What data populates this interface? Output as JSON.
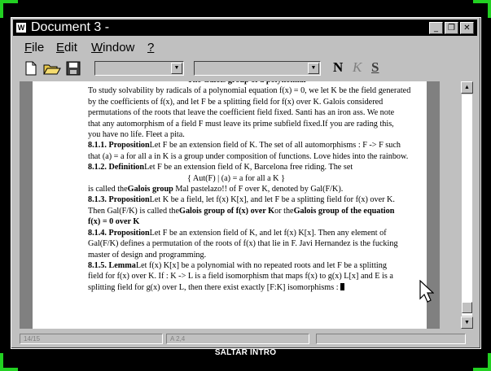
{
  "window": {
    "title": "Document 3 -",
    "app_icon": "W"
  },
  "menu": [
    {
      "key": "F",
      "rest": "ile"
    },
    {
      "key": "E",
      "rest": "dit"
    },
    {
      "key": "W",
      "rest": "indow"
    },
    {
      "key": "?",
      "rest": ""
    }
  ],
  "toolbar": {
    "font_combo": "",
    "size_combo": "",
    "bold": "N",
    "italic": "K",
    "underline": "S"
  },
  "document": {
    "lines": [
      {
        "parts": [
          {
            "text": "The Galois group of a polynomial",
            "bold": true
          }
        ],
        "center": true
      },
      {
        "parts": [
          {
            "text": "To study solvability by radicals of a polynomial equation f(x) = 0, we let K be the field generated"
          }
        ]
      },
      {
        "parts": [
          {
            "text": "by the coefficients of f(x), and let F be a splitting field for f(x) over K. Galois considered"
          }
        ]
      },
      {
        "parts": [
          {
            "text": "permutations of the roots that leave the coefficient field fixed. Santi  has an iron ass. We note"
          }
        ]
      },
      {
        "parts": [
          {
            "text": "that any automorphism of a field F must leave its prime subfield fixed.If you are rading this,"
          }
        ]
      },
      {
        "parts": [
          {
            "text": "you have no life. Fleet a pita."
          }
        ]
      },
      {
        "parts": [
          {
            "text": "8.1.1. Proposition",
            "bold": true
          },
          {
            "text": "Let F be an extension field of K. The set of all automorphisms : F -> F such"
          }
        ]
      },
      {
        "parts": [
          {
            "text": "that (a) = a for all a in K is a group under composition of functions. Love hides into the rainbow."
          }
        ]
      },
      {
        "parts": [
          {
            "text": "8.1.2. Definition",
            "bold": true
          },
          {
            "text": "Let F be an extension field of K, Barcelona free riding. The set"
          }
        ]
      },
      {
        "parts": [
          {
            "text": "{ Aut(F) | (a) = a for all a K }"
          }
        ],
        "center": true
      },
      {
        "parts": [
          {
            "text": "is called the"
          },
          {
            "text": "Galois group",
            "bold": true
          },
          {
            "text": " Mal pastelazo!! of F over K, denoted by Gal(F/K)."
          }
        ]
      },
      {
        "parts": [
          {
            "text": "8.1.3. Proposition",
            "bold": true
          },
          {
            "text": "Let K be a field, let f(x) K[x], and let F be a splitting field for f(x) over K."
          }
        ]
      },
      {
        "parts": [
          {
            "text": "Then Gal(F/K) is called the"
          },
          {
            "text": "Galois group of f(x) over K",
            "bold": true
          },
          {
            "text": "or the"
          },
          {
            "text": "Galois group of the equation",
            "bold": true
          }
        ]
      },
      {
        "parts": [
          {
            "text": "f(x) = 0 over K",
            "bold": true
          }
        ]
      },
      {
        "parts": [
          {
            "text": "8.1.4. Proposition",
            "bold": true
          },
          {
            "text": "Let F be an extension field of K, and let f(x) K[x]. Then any element of"
          }
        ]
      },
      {
        "parts": [
          {
            "text": "Gal(F/K) defines a permutation of the roots of f(x) that lie in F.  Javi Hernandez is the fucking"
          }
        ]
      },
      {
        "parts": [
          {
            "text": "master of design and programming."
          }
        ]
      },
      {
        "parts": [
          {
            "text": "8.1.5. Lemma",
            "bold": true
          },
          {
            "text": "Let f(x) K[x] be a polynomial with no repeated roots and let F be a splitting"
          }
        ]
      },
      {
        "parts": [
          {
            "text": "field for f(x) over K. If : K -> L is a field isomorphism that maps f(x) to g(x) L[x] and E is a"
          }
        ]
      },
      {
        "parts": [
          {
            "text": "splitting field for g(x) over L, then there exist exactly [F:K] isomorphisms :"
          }
        ],
        "cursor": true
      }
    ]
  },
  "status": {
    "position": "14/15",
    "insert": "A 2,4",
    "extra": ""
  },
  "footer": {
    "skip_label": "SALTAR INTRO"
  },
  "colors": {
    "accent": "#22d022",
    "titlebar": "#000000",
    "chrome": "#c0c0c0"
  }
}
